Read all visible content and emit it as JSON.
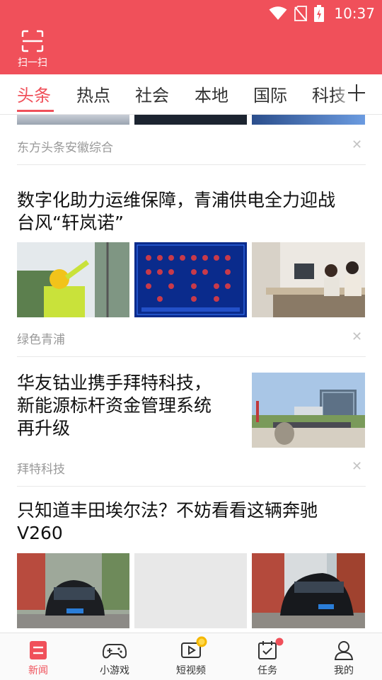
{
  "status": {
    "time": "10:37"
  },
  "header": {
    "scan_label": "扫一扫"
  },
  "tabs": [
    {
      "label": "头条",
      "active": true
    },
    {
      "label": "热点"
    },
    {
      "label": "社会"
    },
    {
      "label": "本地"
    },
    {
      "label": "国际"
    },
    {
      "label": "科技"
    }
  ],
  "feed": {
    "item0": {
      "source": "东方头条安徽综合"
    },
    "item1": {
      "title_line1": "数字化助力运维保障，青浦供电全力迎战",
      "title_line2": "台风“轩岚诺”",
      "source": "绿色青浦"
    },
    "item2": {
      "title_line1": "华友钴业携手拜特科技，",
      "title_line2": "新能源标杆资金管理系统",
      "title_line3": "再升级",
      "source": "拜特科技"
    },
    "item3": {
      "title_line1": "只知道丰田埃尔法？不妨看看这辆奔驰",
      "title_line2": "V260"
    }
  },
  "nav": [
    {
      "label": "新闻",
      "icon": "news-icon",
      "active": true
    },
    {
      "label": "小游戏",
      "icon": "gamepad-icon"
    },
    {
      "label": "短视频",
      "icon": "video-icon"
    },
    {
      "label": "任务",
      "icon": "task-icon"
    },
    {
      "label": "我的",
      "icon": "profile-icon"
    }
  ],
  "colors": {
    "accent": "#f0505a",
    "muted": "#999999",
    "badge_gold": "#f5b800"
  }
}
